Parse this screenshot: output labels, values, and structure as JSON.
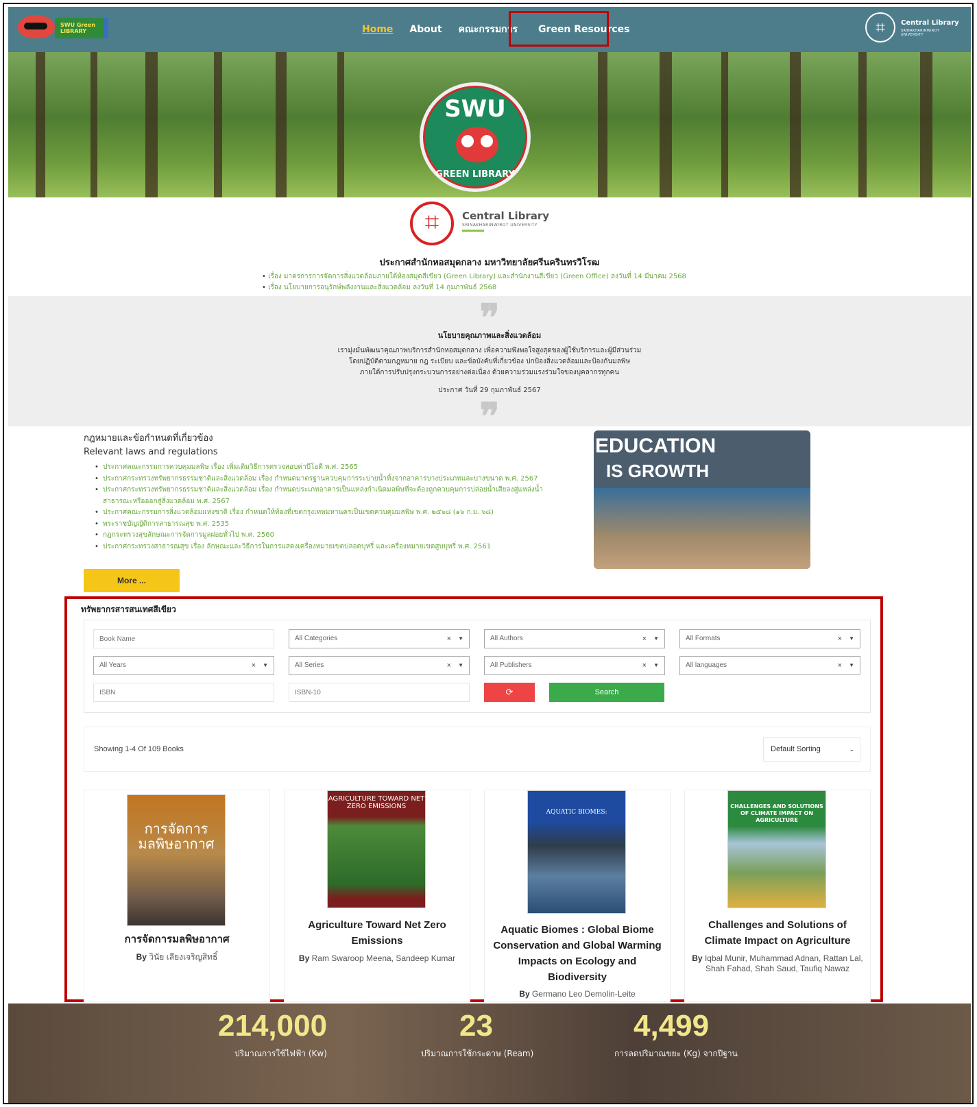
{
  "nav": {
    "brand_text": "SWU Green LIBRARY",
    "links": [
      "Home",
      "About",
      "คณะกรรมการ",
      "Green Resources"
    ],
    "right_logo_title": "Central Library",
    "right_logo_sub": "SRINAKHARINWIROT UNIVERSITY"
  },
  "hero": {
    "badge_top": "SWU",
    "badge_bottom": "GREEN LIBRARY"
  },
  "central_logo": {
    "title": "Central Library",
    "subtitle": "SRINAKHARINWIROT UNIVERSITY"
  },
  "announcement": {
    "title": "ประกาศสำนักหอสมุดกลาง มหาวิทยาลัยศรีนครินทรวิโรฒ",
    "items": [
      "เรื่อง มาตรการการจัดการสิ่งแวดล้อมภายใต้ห้องสมุดสีเขียว (Green Library) และสำนักงานสีเขียว (Green Office) ลงวันที่ 14 มีนาคม 2568",
      "เรื่อง นโยบายการอนุรักษ์พลังงานและสิ่งแวดล้อม ลงวันที่ 14 กุมภาพันธ์ 2568"
    ]
  },
  "policy": {
    "quote_open": "❞",
    "quote_close": "❞",
    "title": "นโยบายคุณภาพและสิ่งแวดล้อม",
    "lines": [
      "เรามุ่งมั่นพัฒนาคุณภาพบริการสำนักหอสมุดกลาง เพื่อความพึงพอใจสูงสุดของผู้ใช้บริการและผู้มีส่วนร่วม",
      "โดยปฏิบัติตามกฎหมาย กฎ ระเบียบ และข้อบังคับที่เกี่ยวข้อง ปกป้องสิ่งแวดล้อมและป้องกันมลพิษ",
      "ภายใต้การปรับปรุงกระบวนการอย่างต่อเนื่อง ด้วยความร่วมแรงร่วมใจของบุคลากรทุกคน"
    ],
    "date": "ประกาศ วันที่ 29 กุมภาพันธ์ 2567"
  },
  "laws": {
    "heading_th": "กฎหมายและข้อกำหนดที่เกี่ยวข้อง",
    "heading_en": "Relevant laws and regulations",
    "items": [
      "ประกาศคณะกรรมการควบคุมมลพิษ เรื่อง เพิ่มเติมวิธีการตรวจสอบค่าบีโอดี พ.ศ. 2565",
      "ประกาศกระทรวงทรัพยากรธรรมชาติและสิ่งแวดล้อม เรื่อง กำหนดมาตรฐานควบคุมการระบายน้ำทิ้งจากอาคารบางประเภทและบางขนาด พ.ศ. 2567",
      "ประกาศกระทรวงทรัพยากรธรรมชาติและสิ่งแวดล้อม เรื่อง กำหนดประเภทอาคารเป็นแหล่งกำเนิดมลพิษที่จะต้องถูกควบคุมการปล่อยน้ำเสียลงสู่แหล่งน้ำสาธารณะหรือออกสู่สิ่งแวดล้อม พ.ศ. 2567",
      "ประกาศคณะกรรมการสิ่งแวดล้อมแห่งชาติ เรื่อง กำหนดให้ท้องที่เขตกรุงเทพมหานครเป็นเขตควบคุมมลพิษ พ.ศ. ๒๕๖๘ (๑๖ ก.ย. ๖๘)",
      "พระราชบัญญัติการสาธารณสุข พ.ศ. 2535",
      "กฎกระทรวงสุขลักษณะการจัดการมูลฝอยทั่วไป พ.ศ. 2560",
      "ประกาศกระทรวงสาธารณสุข เรื่อง ลักษณะและวิธีการในการแสดงเครื่องหมายเขตปลอดบุหรี่ และเครื่องหมายเขตสูบบุหรี่ พ.ศ. 2561"
    ],
    "more_label": "More ...",
    "edu_line1": "EDUCATION",
    "edu_line2": "IS GROWTH"
  },
  "resources": {
    "title": "ทรัพยากรสารสนเทศสีเขียว",
    "filters": {
      "book_name_placeholder": "Book Name",
      "categories": "All Categories",
      "authors": "All Authors",
      "formats": "All Formats",
      "years": "All Years",
      "series": "All Series",
      "publishers": "All Publishers",
      "languages": "All languages",
      "isbn_placeholder": "ISBN",
      "isbn10_placeholder": "ISBN-10",
      "refresh_icon": "⟳",
      "search_label": "Search",
      "clear_glyph": "×",
      "caret_glyph": "▼"
    },
    "showing": "Showing 1-4 Of 109 Books",
    "sorting": "Default Sorting",
    "books": [
      {
        "cover_text": "การจัดการ มลพิษอากาศ",
        "title": "การจัดการมลพิษอากาศ",
        "by": "By",
        "author": "วินัย เลียงเจริญสิทธิ์"
      },
      {
        "cover_text": "AGRICULTURE TOWARD NET ZERO EMISSIONS",
        "title": "Agriculture Toward Net Zero Emissions",
        "by": "By",
        "author": "Ram Swaroop Meena, Sandeep Kumar"
      },
      {
        "cover_text": "AQUATIC BIOMES:",
        "title": "Aquatic Biomes : Global Biome Conservation and Global Warming Impacts on Ecology and Biodiversity",
        "by": "By",
        "author": "Germano Leo Demolin-Leite"
      },
      {
        "cover_text": "CHALLENGES AND SOLUTIONS OF CLIMATE IMPACT ON AGRICULTURE",
        "title": "Challenges and Solutions of Climate Impact on Agriculture",
        "by": "By",
        "author": "Iqbal Munir, Muhammad Adnan, Rattan Lal, Shah Fahad, Shah Saud, Taufiq Nawaz"
      }
    ]
  },
  "stats": [
    {
      "value": "214,000",
      "label": "ปริมาณการใช้ไฟฟ้า (Kw)"
    },
    {
      "value": "23",
      "label": "ปริมาณการใช้กระดาษ (Ream)"
    },
    {
      "value": "4,499",
      "label": "การลดปริมาณขยะ (Kg) จากปีฐาน"
    }
  ],
  "colors": {
    "nav_bg": "#4d7d8b",
    "active_link": "#f4c430",
    "highlight_border": "#c00000",
    "link_green": "#6aa83e",
    "more_button": "#f5c518",
    "search_button": "#3aaa4a",
    "refresh_button": "#ef4444",
    "stat_number": "#f1e78a"
  }
}
